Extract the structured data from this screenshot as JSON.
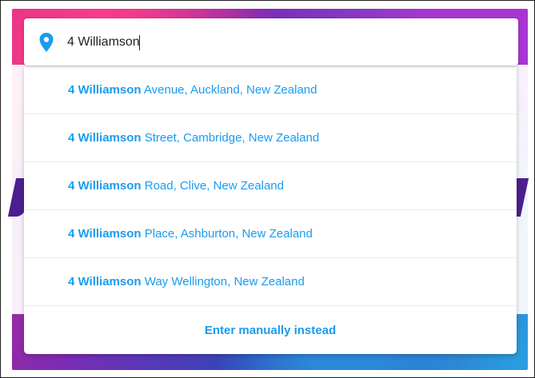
{
  "search": {
    "value": "4 Williamson",
    "icon": "location-pin-icon"
  },
  "suggestions": [
    {
      "match": "4 Williamson",
      "rest": " Avenue, Auckland, New Zealand"
    },
    {
      "match": "4 Williamson",
      "rest": " Street, Cambridge, New Zealand"
    },
    {
      "match": "4 Williamson",
      "rest": " Road, Clive, New Zealand"
    },
    {
      "match": "4 Williamson",
      "rest": " Place, Ashburton, New Zealand"
    },
    {
      "match": "4 Williamson",
      "rest": " Way Wellington, New Zealand"
    }
  ],
  "manual": {
    "label": "Enter manually instead"
  },
  "colors": {
    "accent": "#1a9bf0",
    "text": "#222222"
  }
}
